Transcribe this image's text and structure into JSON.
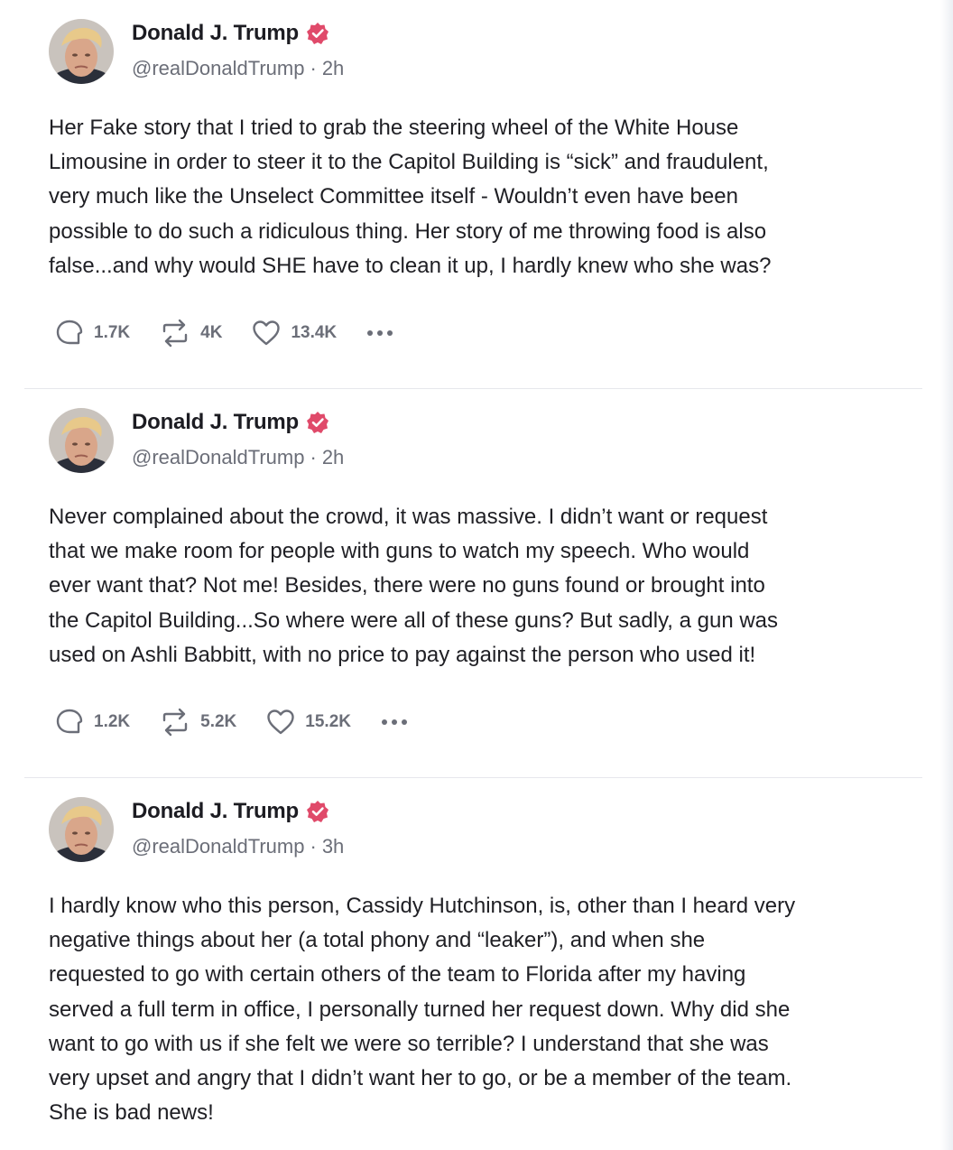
{
  "colors": {
    "verified_badge": "#e04a6a",
    "muted_text": "#6b6e78"
  },
  "posts": [
    {
      "author": "Donald J. Trump",
      "handle": "@realDonaldTrump",
      "time": "2h",
      "text": "Her Fake story that I tried to  grab the steering wheel of the White House\nLimousine in order to steer it to the Capitol Building is “sick” and fraudulent,\nvery much like the Unselect Committee itself - Wouldn’t even have been\npossible to do such a ridiculous thing. Her story of me throwing food is also\nfalse...and why would SHE have to clean it up, I hardly knew who she was?",
      "replies": "1.7K",
      "reposts": "4K",
      "likes": "13.4K"
    },
    {
      "author": "Donald J. Trump",
      "handle": "@realDonaldTrump",
      "time": "2h",
      "text": "Never complained about the crowd, it was massive. I didn’t want or request\nthat we make room for people with guns to watch my speech. Who would\never want that? Not me! Besides, there were no guns found or brought into\nthe Capitol Building...So where were all of these guns? But sadly, a gun was\nused on Ashli Babbitt, with no price to pay against the person who used it!",
      "replies": "1.2K",
      "reposts": "5.2K",
      "likes": "15.2K"
    },
    {
      "author": "Donald J. Trump",
      "handle": "@realDonaldTrump",
      "time": "3h",
      "text": "I hardly know who this person, Cassidy Hutchinson, is, other than I heard very\nnegative things about her (a total phony and “leaker”), and when she\nrequested to go with certain others of the team to Florida after my having\nserved a full term in office, I personally turned her request down. Why did she\nwant to go with us if she felt we were so terrible? I understand that she was\nvery upset and angry that I didn’t want her to go, or be a member of the team.\nShe is bad news!"
    }
  ],
  "icons": {
    "reply": "speech-bubble-icon",
    "repost": "repost-arrows-icon",
    "like": "heart-icon",
    "more": "ellipsis-icon",
    "verified": "verified-badge-icon"
  }
}
